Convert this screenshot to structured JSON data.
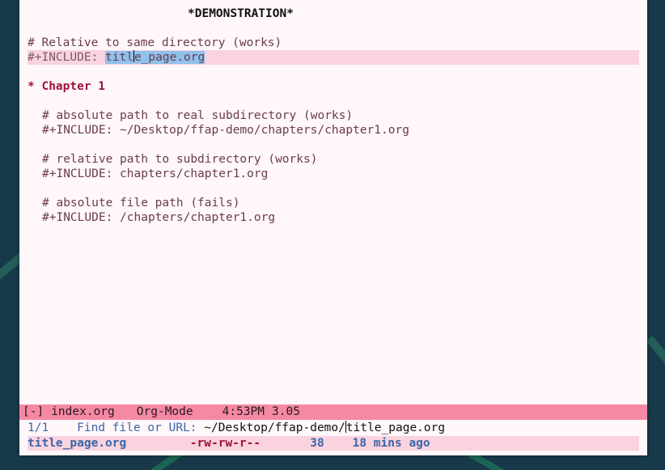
{
  "buffer": {
    "title": "*DEMONSTRATION*",
    "comment1": "# Relative to same directory (works)",
    "include1_keyword": "#+INCLUDE: ",
    "include1_region": "titl",
    "include1_rest": "e_page.org",
    "heading": "* Chapter 1",
    "comment2": "# absolute path to real subdirectory (works)",
    "include2": "#+INCLUDE: ~/Desktop/ffap-demo/chapters/chapter1.org",
    "comment3": "# relative path to subdirectory (works)",
    "include3": "#+INCLUDE: chapters/chapter1.org",
    "comment4": "# absolute file path (fails)",
    "include4": "#+INCLUDE: /chapters/chapter1.org"
  },
  "mode_line": {
    "status": "[-]",
    "buffer_name": "index.org",
    "mode": "Org-Mode",
    "time": "4:53PM",
    "load": "3.05"
  },
  "minibuffer": {
    "count": "1/1",
    "prompt": "Find file or URL: ",
    "input_dir": "~/Desktop/ffap-demo/",
    "input_file": "title_page.org"
  },
  "completion": {
    "file": "title_page.org",
    "permissions": "-rw-rw-r--",
    "size": "38",
    "modified": "18 mins ago"
  },
  "colors": {
    "mode_line_bg": "#f589a4",
    "heading": "#a0123b",
    "region": "#8fc1ec",
    "highlight_line": "#f9d3de"
  }
}
